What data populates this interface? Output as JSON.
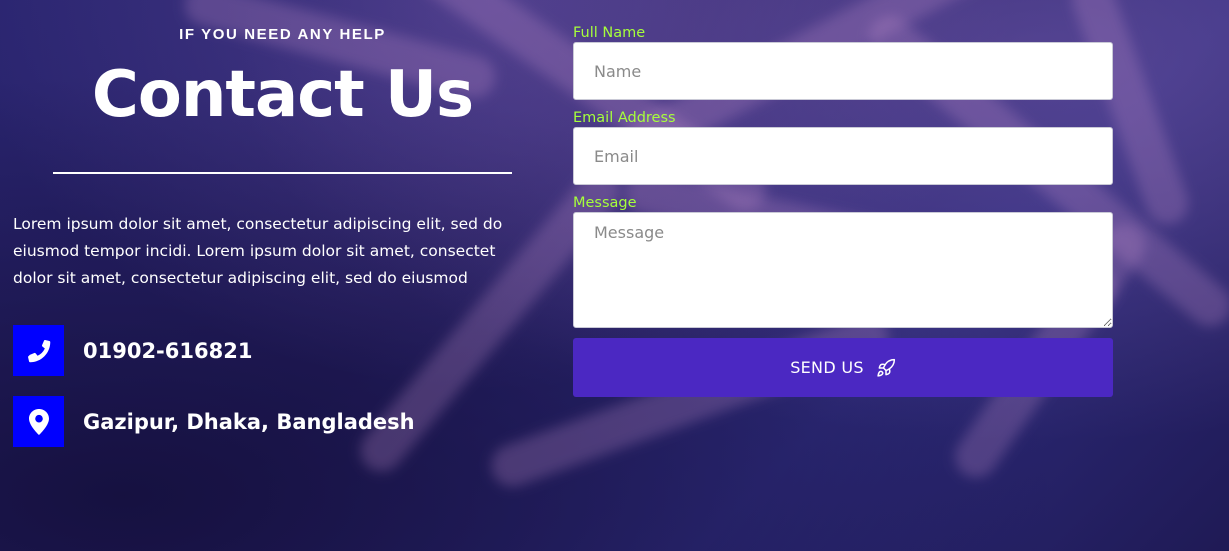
{
  "header": {
    "eyebrow": "IF YOU NEED ANY HELP",
    "title": "Contact Us"
  },
  "intro": {
    "text": "Lorem ipsum dolor sit amet, consectetur adipiscing elit, sed do eiusmod tempor incidi. Lorem ipsum dolor sit amet, consectet dolor sit amet, consectetur adipiscing elit, sed do eiusmod"
  },
  "contact_info": {
    "phone": {
      "icon": "phone-icon",
      "text": "01902-616821"
    },
    "address": {
      "icon": "map-marker-icon",
      "text": "Gazipur, Dhaka, Bangladesh"
    }
  },
  "form": {
    "name": {
      "label": "Full Name",
      "placeholder": "Name",
      "value": ""
    },
    "email": {
      "label": "Email Address",
      "placeholder": "Email",
      "value": ""
    },
    "message": {
      "label": "Message",
      "placeholder": "Message",
      "value": ""
    },
    "submit": {
      "label": "SEND US",
      "icon": "rocket-icon"
    }
  },
  "colors": {
    "accent_label": "#a6ff3b",
    "icon_bg": "#0000ff",
    "button_bg": "#4b28c2",
    "background": "#241d5a"
  }
}
